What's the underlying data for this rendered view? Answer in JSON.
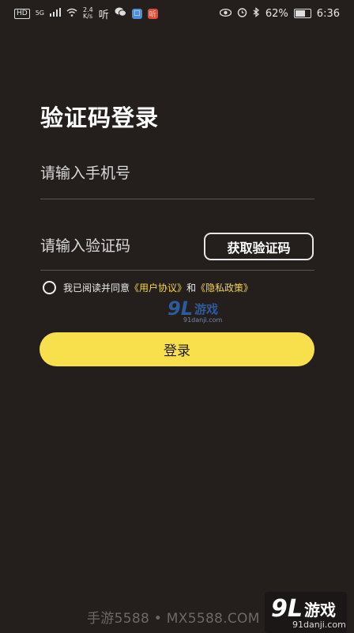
{
  "status_bar": {
    "hd": "HD",
    "network": "5G",
    "speed_top": "2.4",
    "speed_bottom": "K/s",
    "app1": "听",
    "app3": "□",
    "app4": "听",
    "battery": "62%",
    "time": "6:36"
  },
  "page": {
    "title": "验证码登录"
  },
  "form": {
    "phone_placeholder": "请输入手机号",
    "code_placeholder": "请输入验证码",
    "get_code_label": "获取验证码",
    "agree_prefix": "我已阅读并同意",
    "user_agreement": "《用户协议》",
    "and_text": "和",
    "privacy_policy": "《隐私政策》",
    "login_label": "登录"
  },
  "watermark": {
    "num": "9L",
    "cn": "游戏",
    "url": "91danji.com"
  },
  "footer": {
    "text": "手游5588 • MX5588.COM",
    "logo_num": "9L",
    "logo_cn": "游戏",
    "logo_url": "91danji.com"
  },
  "colors": {
    "background": "#241f1d",
    "accent": "#f7e04b",
    "link": "#f3d54c"
  }
}
